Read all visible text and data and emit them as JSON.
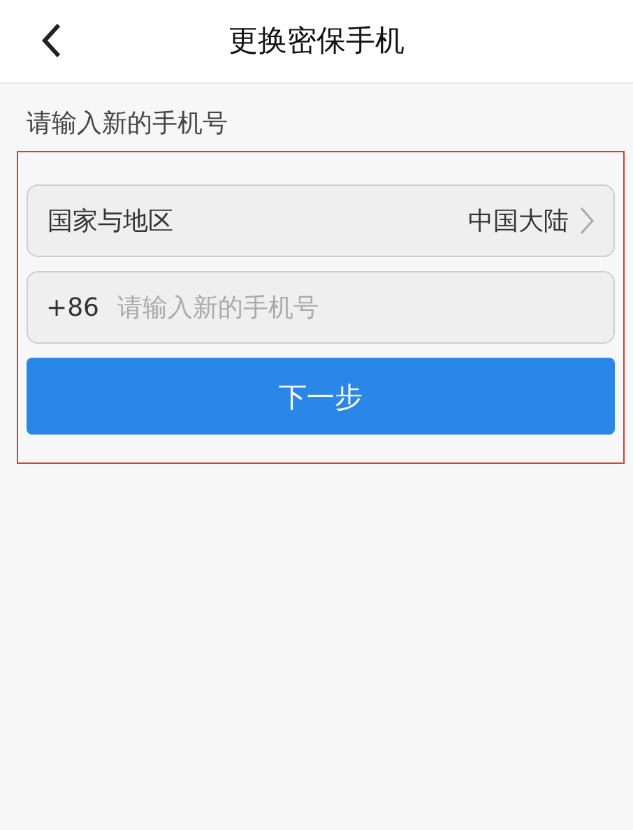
{
  "header": {
    "title": "更换密保手机"
  },
  "prompt": "请输入新的手机号",
  "region": {
    "label": "国家与地区",
    "value": "中国大陆"
  },
  "phone": {
    "code": "+86",
    "placeholder": "请输入新的手机号"
  },
  "next_button": "下一步"
}
